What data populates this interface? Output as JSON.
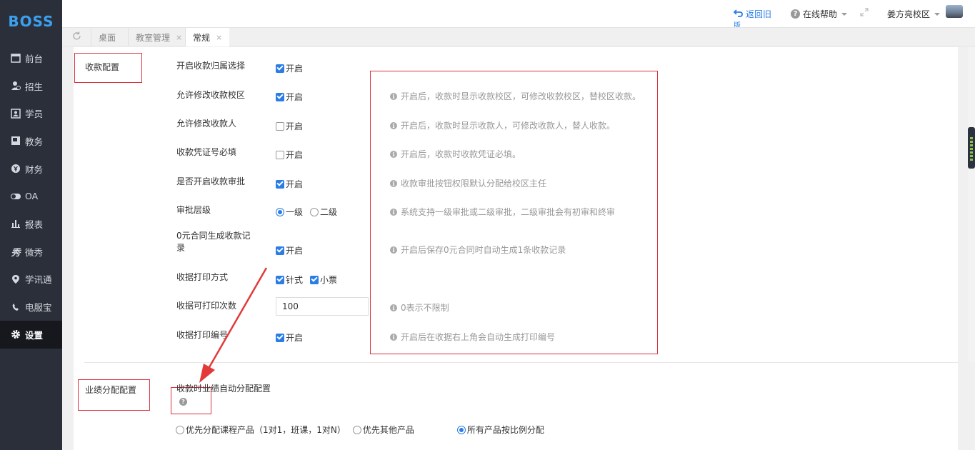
{
  "logo": "BOSS",
  "sidebar": {
    "items": [
      {
        "label": "前台",
        "icon": "calendar-icon"
      },
      {
        "label": "招生",
        "icon": "person-add-icon"
      },
      {
        "label": "学员",
        "icon": "id-card-icon"
      },
      {
        "label": "教务",
        "icon": "book-icon"
      },
      {
        "label": "财务",
        "icon": "yen-icon"
      },
      {
        "label": "OA",
        "icon": "toggle-icon"
      },
      {
        "label": "报表",
        "icon": "bar-chart-icon"
      },
      {
        "label": "微秀",
        "icon": "show-icon"
      },
      {
        "label": "学讯通",
        "icon": "location-icon"
      },
      {
        "label": "电服宝",
        "icon": "phone-icon"
      },
      {
        "label": "设置",
        "icon": "gear-icon"
      }
    ],
    "active_index": 10
  },
  "header": {
    "back_label": "返回旧",
    "back_sub": "版",
    "help_label": "在线帮助",
    "campus_label": "姜方亮校区"
  },
  "tabs": [
    {
      "label": "桌面"
    },
    {
      "label": "教室管理"
    },
    {
      "label": "常规"
    }
  ],
  "sections": {
    "payment_title": "收款配置",
    "performance_title": "业绩分配配置"
  },
  "settings": {
    "s1": {
      "label": "开启收款归属选择",
      "option": "开启",
      "checked": true,
      "hint": ""
    },
    "s2": {
      "label": "允许修改收款校区",
      "option": "开启",
      "checked": true,
      "hint": "开启后，收款时显示收款校区，可修改收款校区，替校区收款。"
    },
    "s3": {
      "label": "允许修改收款人",
      "option": "开启",
      "checked": false,
      "hint": "开启后，收款时显示收款人，可修改收款人，替人收款。"
    },
    "s4": {
      "label": "收款凭证号必填",
      "option": "开启",
      "checked": false,
      "hint": "开启后，收款时收款凭证必填。"
    },
    "s5": {
      "label": "是否开启收款审批",
      "option": "开启",
      "checked": true,
      "hint": "收款审批按钮权限默认分配给校区主任"
    },
    "s6": {
      "label": "审批层级",
      "option1": "一级",
      "option2": "二级",
      "hint": "系统支持一级审批或二级审批，二级审批会有初审和终审"
    },
    "s7": {
      "label_line1": "0元合同生成收款记",
      "label_line2": "录",
      "option": "开启",
      "checked": true,
      "hint": "开启后保存0元合同时自动生成1条收款记录"
    },
    "s8": {
      "label": "收据打印方式",
      "option1": "针式",
      "option2": "小票"
    },
    "s9": {
      "label": "收据可打印次数",
      "value": "100",
      "hint": "0表示不限制"
    },
    "s10": {
      "label": "收据打印编号",
      "option": "开启",
      "checked": true,
      "hint": "开启后在收据右上角会自动生成打印编号"
    }
  },
  "performance": {
    "label": "收款时业绩自动分配配置",
    "opt1": "优先分配课程产品（1对1，班课，1对N）",
    "opt2": "优先其他产品",
    "opt3": "所有产品按比例分配",
    "selected": 3
  },
  "colors": {
    "accent": "#2b7de6",
    "annotation": "#d9333f",
    "sidebar": "#2b2f3a"
  }
}
